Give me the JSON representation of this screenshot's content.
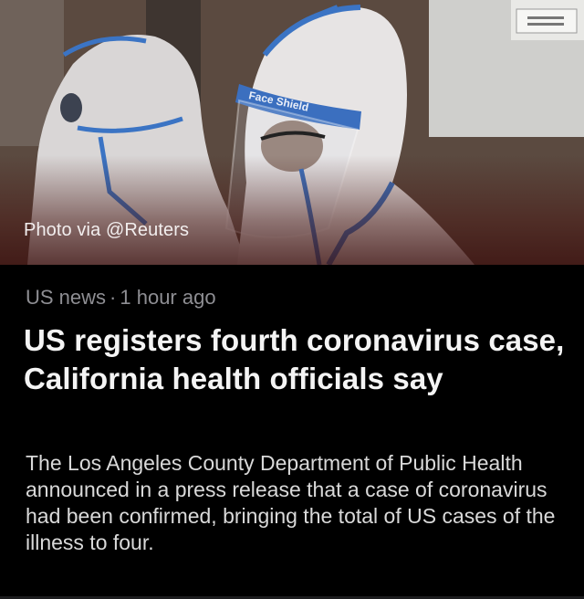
{
  "photo": {
    "credit": "Photo via @Reuters",
    "shield_label": "Face Shield"
  },
  "article": {
    "category": "US news",
    "separator": "·",
    "time": "1 hour ago",
    "headline": "US registers fourth coronavirus case, California health officials say",
    "summary": "The Los Angeles County Department of Public Health announced in a press release that a case of coronavirus had been confirmed, bringing the total of US cases of the illness to four."
  },
  "colors": {
    "background": "#000000",
    "headline": "#f4f4f4",
    "meta": "#8e8e93",
    "summary": "#d9d9d9",
    "suit_trim": "#3b74c4"
  }
}
